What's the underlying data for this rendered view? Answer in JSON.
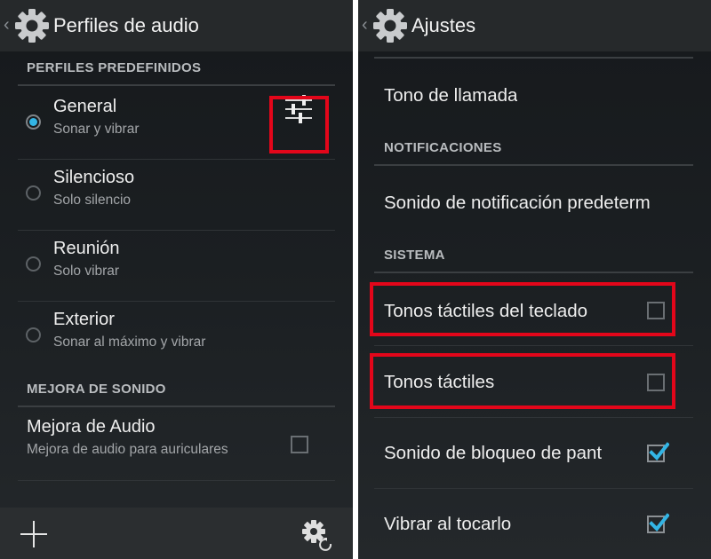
{
  "left": {
    "title": "Perfiles de audio",
    "icons": {
      "back": "chevron-left-icon",
      "app": "gear-icon"
    },
    "section_predefined": "PERFILES PREDEFINIDOS",
    "profiles": [
      {
        "name": "General",
        "subtitle": "Sonar y vibrar",
        "selected": true
      },
      {
        "name": "Silencioso",
        "subtitle": "Solo silencio",
        "selected": false
      },
      {
        "name": "Reunión",
        "subtitle": "Solo vibrar",
        "selected": false
      },
      {
        "name": "Exterior",
        "subtitle": "Sonar al máximo y vibrar",
        "selected": false
      }
    ],
    "section_enhancement": "MEJORA DE SONIDO",
    "enhancement": {
      "name": "Mejora de Audio",
      "subtitle": "Mejora de audio para auriculares",
      "checked": false
    },
    "bottom": {
      "add_icon": "plus-icon",
      "reset_icon": "gear-reset-icon"
    }
  },
  "right": {
    "title": "Ajustes",
    "icons": {
      "back": "chevron-left-icon",
      "app": "gear-icon"
    },
    "ringtone": "Tono de llamada",
    "section_notifications": "NOTIFICACIONES",
    "notification_sound": "Sonido de notificación predeterm",
    "section_system": "SISTEMA",
    "system_items": [
      {
        "label": "Tonos táctiles del teclado",
        "checked": false
      },
      {
        "label": "Tonos táctiles",
        "checked": false
      },
      {
        "label": "Sonido de bloqueo de pant",
        "checked": true
      },
      {
        "label": "Vibrar al tocarlo",
        "checked": true
      }
    ]
  },
  "colors": {
    "accent": "#33b5e5",
    "highlight": "#e3061a",
    "background": "#1c2023"
  }
}
